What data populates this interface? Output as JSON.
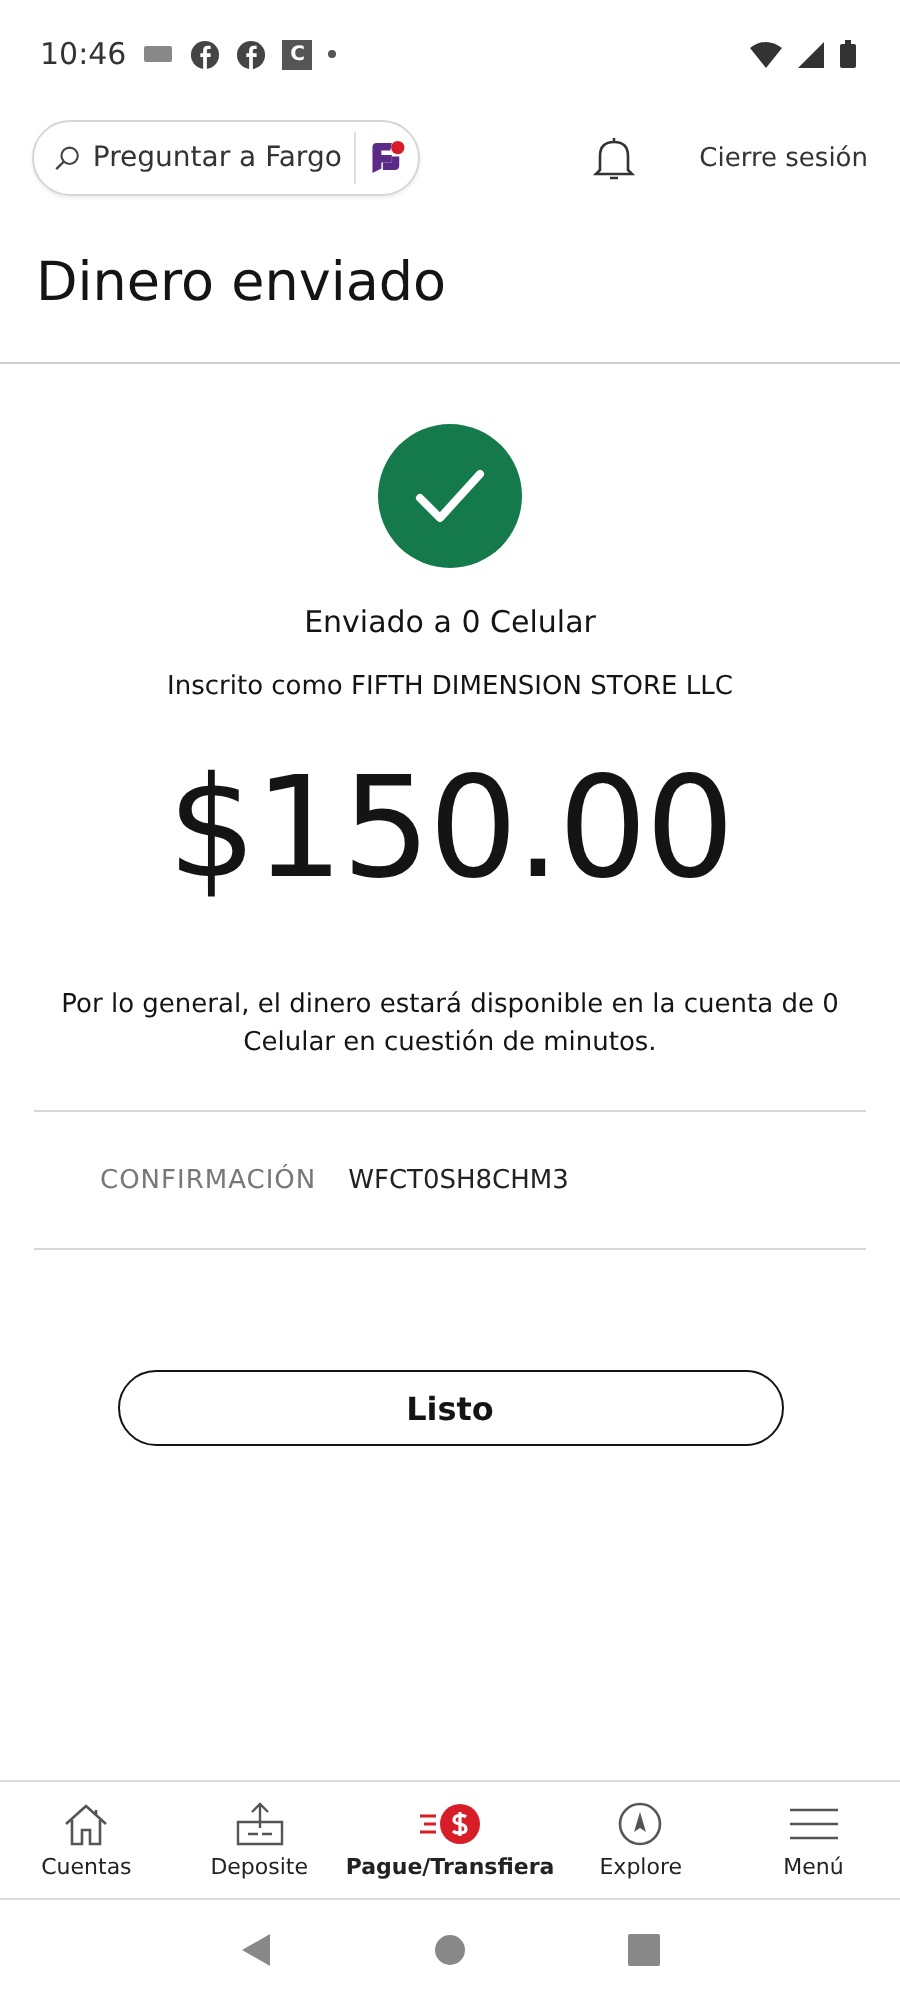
{
  "status_bar": {
    "time": "10:46",
    "app_badge": "C"
  },
  "header": {
    "search_placeholder": "Preguntar a Fargo",
    "logout": "Cierre sesión"
  },
  "title": "Dinero enviado",
  "result": {
    "recipient": "Enviado a 0 Celular",
    "enrolled": "Inscrito como FIFTH DIMENSION STORE LLC",
    "amount": "$150.00",
    "note": "Por lo general, el dinero estará disponible en la cuenta de 0 Celular en cuestión de minutos."
  },
  "confirmation": {
    "label": "CONFIRMACIÓN",
    "value": "WFCT0SH8CHM3"
  },
  "done_button": "Listo",
  "bottom_nav": [
    {
      "kind": "home",
      "label": "Cuentas",
      "selected": false
    },
    {
      "kind": "deposit",
      "label": "Deposite",
      "selected": false
    },
    {
      "kind": "pay",
      "label": "Pague/Transfiera",
      "selected": true
    },
    {
      "kind": "explore",
      "label": "Explore",
      "selected": false
    },
    {
      "kind": "menu",
      "label": "Menú",
      "selected": false
    }
  ]
}
